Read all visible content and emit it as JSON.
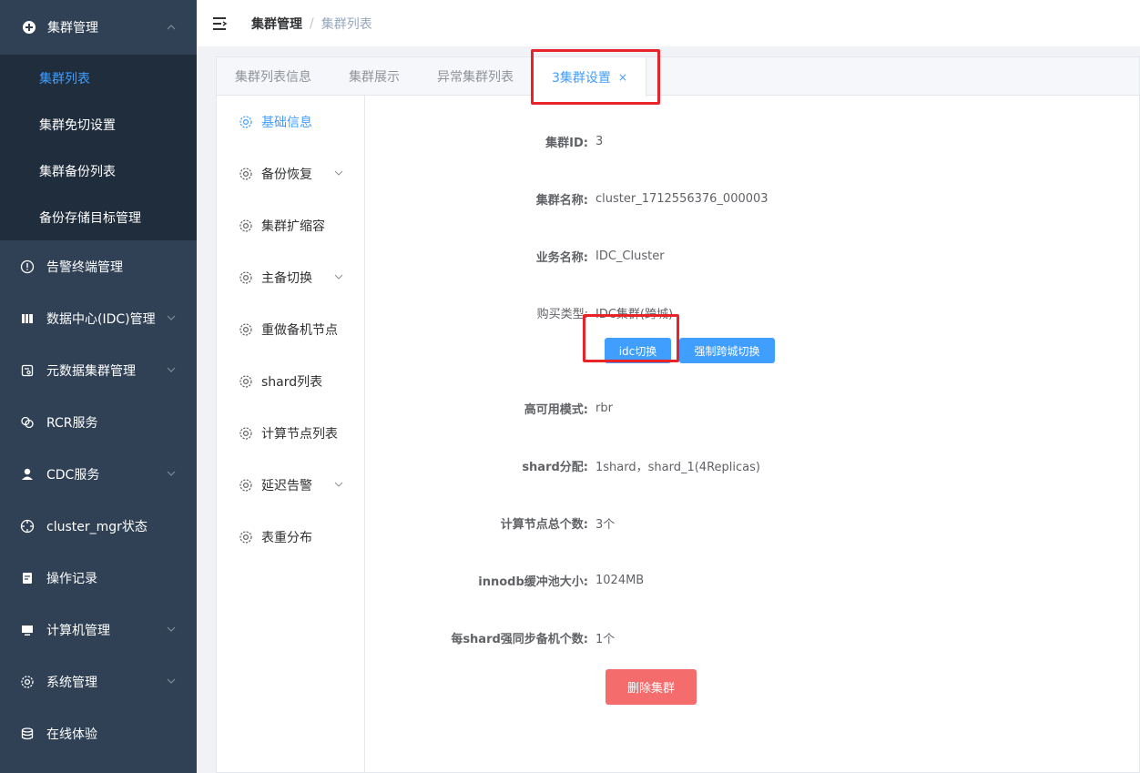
{
  "sidebar": {
    "group": {
      "label": "集群管理",
      "icon": "plus-circle-icon",
      "items": [
        {
          "label": "集群列表",
          "active": true
        },
        {
          "label": "集群免切设置"
        },
        {
          "label": "集群备份列表"
        },
        {
          "label": "备份存储目标管理"
        }
      ]
    },
    "items": [
      {
        "label": "告警终端管理",
        "icon": "alert-circle-icon"
      },
      {
        "label": "数据中心(IDC)管理",
        "icon": "datacenter-icon"
      },
      {
        "label": "元数据集群管理",
        "icon": "metadata-icon"
      },
      {
        "label": "RCR服务",
        "icon": "link-icon"
      },
      {
        "label": "CDC服务",
        "icon": "user-icon"
      },
      {
        "label": "cluster_mgr状态",
        "icon": "crosshair-icon"
      },
      {
        "label": "操作记录",
        "icon": "record-icon"
      },
      {
        "label": "计算机管理",
        "icon": "monitor-icon"
      },
      {
        "label": "系统管理",
        "icon": "gear-icon"
      },
      {
        "label": "在线体验",
        "icon": "database-icon"
      }
    ]
  },
  "breadcrumb": {
    "first": "集群管理",
    "sep": "/",
    "current": "集群列表"
  },
  "tabs": [
    {
      "label": "集群列表信息"
    },
    {
      "label": "集群展示"
    },
    {
      "label": "异常集群列表"
    },
    {
      "label": "3集群设置",
      "active": true,
      "close": "×"
    }
  ],
  "side_menu": [
    {
      "label": "基础信息",
      "active": true
    },
    {
      "label": "备份恢复",
      "expandable": true
    },
    {
      "label": "集群扩缩容"
    },
    {
      "label": "主备切换",
      "expandable": true
    },
    {
      "label": "重做备机节点"
    },
    {
      "label": "shard列表"
    },
    {
      "label": "计算节点列表"
    },
    {
      "label": "延迟告警",
      "expandable": true
    },
    {
      "label": "表重分布"
    }
  ],
  "detail": {
    "cluster_id": {
      "label": "集群ID:",
      "value": "3"
    },
    "cluster_name": {
      "label": "集群名称:",
      "value": "cluster_1712556376_000003"
    },
    "business_name": {
      "label": "业务名称:",
      "value": "IDC_Cluster"
    },
    "purchase_type": {
      "label": "购买类型:",
      "value": "IDC集群(跨城)"
    },
    "idc_switch_button": "idc切换",
    "force_switch_button": "强制跨城切换",
    "ha_mode": {
      "label": "高可用模式:",
      "value": "rbr"
    },
    "shard_alloc": {
      "label": "shard分配:",
      "value": "1shard，shard_1(4Replicas)"
    },
    "compute_nodes": {
      "label": "计算节点总个数:",
      "value": "3个"
    },
    "innodb_pool": {
      "label": "innodb缓冲池大小:",
      "value": "1024MB"
    },
    "sync_replicas": {
      "label": "每shard强同步备机个数:",
      "value": "1个"
    },
    "delete_button": "删除集群"
  },
  "colors": {
    "sidebar_bg": "#304156",
    "submenu_bg": "#1f2d3d",
    "primary": "#409eff",
    "danger": "#f56c6c",
    "highlight": "#e8242a"
  }
}
